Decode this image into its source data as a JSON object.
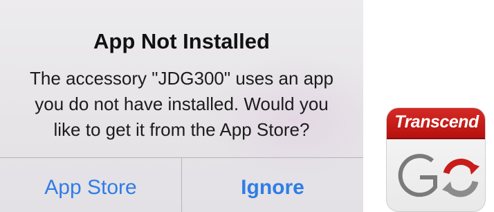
{
  "alert": {
    "title": "App Not Installed",
    "message_lines": [
      "The accessory \"JDG300\" uses an app",
      "you do not have installed. Would you",
      "like to get it from the App Store?"
    ],
    "buttons": {
      "primary_label": "App Store",
      "secondary_label": "Ignore"
    }
  },
  "app_icon": {
    "brand_text": "Transcend",
    "logo_text": "GO",
    "icon": "transcend-go-app-icon"
  },
  "colors": {
    "button_blue": "#2f7de6",
    "brand_red": "#c81d1a"
  }
}
